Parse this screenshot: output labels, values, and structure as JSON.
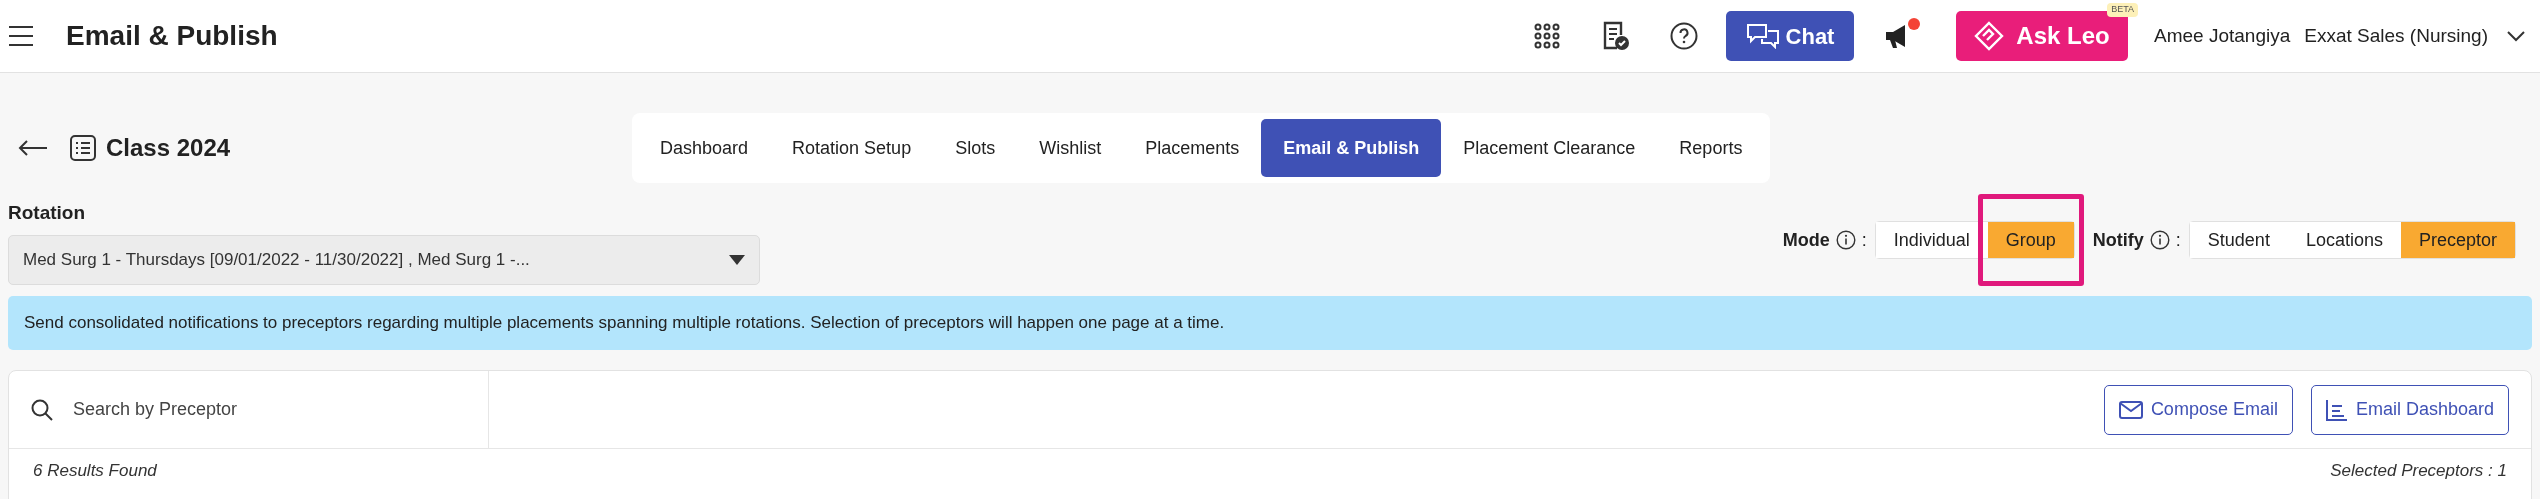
{
  "header": {
    "title": "Email & Publish",
    "chat_label": "Chat",
    "announcement_alert": true,
    "ask_leo": {
      "label": "Ask Leo",
      "badge": "BETA"
    },
    "user": "Amee Jotangiya",
    "organization": "Exxat Sales (Nursing)"
  },
  "class_title": "Class 2024",
  "tabs": [
    {
      "label": "Dashboard",
      "selected": false
    },
    {
      "label": "Rotation Setup",
      "selected": false
    },
    {
      "label": "Slots",
      "selected": false
    },
    {
      "label": "Wishlist",
      "selected": false
    },
    {
      "label": "Placements",
      "selected": false
    },
    {
      "label": "Email & Publish",
      "selected": true
    },
    {
      "label": "Placement Clearance",
      "selected": false
    },
    {
      "label": "Reports",
      "selected": false
    }
  ],
  "rotation": {
    "label": "Rotation",
    "value": "Med Surg 1 - Thursdays [09/01/2022 - 11/30/2022] , Med Surg 1 -..."
  },
  "mode": {
    "label": "Mode",
    "separator": ":",
    "options": [
      {
        "label": "Individual",
        "selected": false,
        "highlighted": false
      },
      {
        "label": "Group",
        "selected": true,
        "highlighted": true
      }
    ]
  },
  "notify": {
    "label": "Notify",
    "separator": ":",
    "options": [
      {
        "label": "Student",
        "selected": false
      },
      {
        "label": "Locations",
        "selected": false
      },
      {
        "label": "Preceptor",
        "selected": true
      }
    ]
  },
  "banner": "Send consolidated notifications to preceptors regarding multiple placements spanning multiple rotations. Selection of preceptors will happen one page at a time.",
  "search": {
    "placeholder": "Search by Preceptor"
  },
  "buttons": [
    {
      "label": "Compose Email",
      "kind": "compose"
    },
    {
      "label": "Email Dashboard",
      "kind": "dashboard"
    }
  ],
  "results": "6 Results Found",
  "selected_count": "Selected Preceptors : 1"
}
